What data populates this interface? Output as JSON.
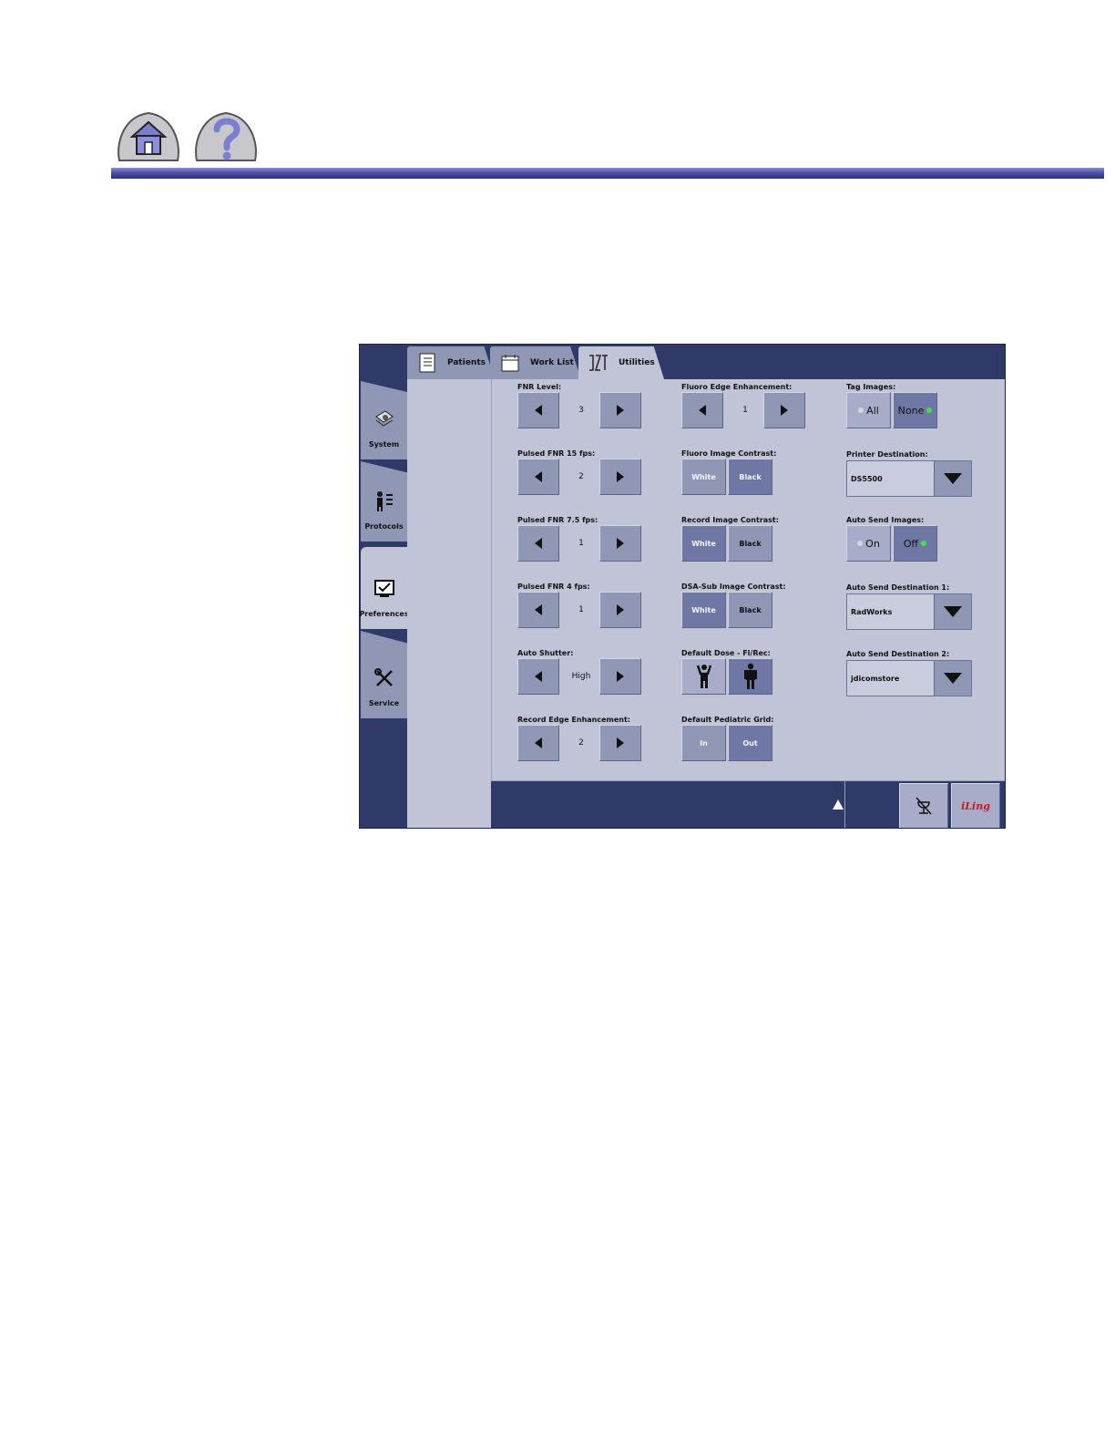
{
  "nav": {
    "home_icon": "home-icon",
    "help_icon": "help-icon"
  },
  "tabs": [
    {
      "label": "Patients",
      "icon": "patients-icon"
    },
    {
      "label": "Work List",
      "icon": "worklist-icon"
    },
    {
      "label": "Utilities",
      "icon": "utilities-icon",
      "active": true
    }
  ],
  "sidebar": [
    {
      "label": "System",
      "icon": "system-icon"
    },
    {
      "label": "Protocols",
      "icon": "protocols-icon"
    },
    {
      "label": "Preferences",
      "icon": "preferences-icon",
      "active": true
    },
    {
      "label": "Service",
      "icon": "service-icon"
    }
  ],
  "column1": [
    {
      "label": "FNR Level:",
      "value": "3"
    },
    {
      "label": "Pulsed FNR 15 fps:",
      "value": "2"
    },
    {
      "label": "Pulsed FNR 7.5 fps:",
      "value": "1"
    },
    {
      "label": "Pulsed FNR 4 fps:",
      "value": "1"
    },
    {
      "label": "Auto Shutter:",
      "value": "High"
    },
    {
      "label": "Record Edge Enhancement:",
      "value": "2"
    }
  ],
  "column2": {
    "fluoro_edge": {
      "label": "Fluoro Edge Enhancement:",
      "value": "1"
    },
    "fluoro_contrast": {
      "label": "Fluoro Image Contrast:",
      "options": [
        "White",
        "Black"
      ],
      "selected": "Black"
    },
    "record_contrast": {
      "label": "Record Image Contrast:",
      "options": [
        "White",
        "Black"
      ],
      "selected": "White"
    },
    "dsa_contrast": {
      "label": "DSA-Sub Image Contrast:",
      "options": [
        "White",
        "Black"
      ],
      "selected": "White"
    },
    "default_dose": {
      "label": "Default Dose - Fl/Rec:"
    },
    "pediatric_grid": {
      "label": "Default Pediatric Grid:",
      "options": [
        "In",
        "Out"
      ],
      "selected": "Out"
    }
  },
  "column3": {
    "tag_images": {
      "label": "Tag Images:",
      "options": [
        "All",
        "None"
      ],
      "selected": "None"
    },
    "printer_destination": {
      "label": "Printer Destination:",
      "value": "DS5500"
    },
    "auto_send_images": {
      "label": "Auto Send Images:",
      "options": [
        "On",
        "Off"
      ],
      "selected": "Off"
    },
    "auto_send_dest1": {
      "label": "Auto Send Destination 1:",
      "value": "RadWorks"
    },
    "auto_send_dest2": {
      "label": "Auto Send Destination 2:",
      "value": "jdicomstore"
    }
  },
  "bottom": {
    "iling_label": "iLing"
  }
}
